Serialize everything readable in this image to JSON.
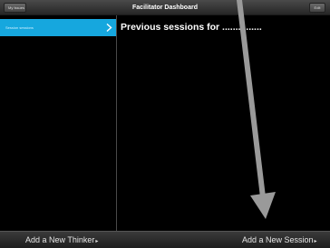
{
  "navbar": {
    "left_button": "My Issues",
    "title": "Facilitator Dashboard",
    "right_button": "Edit"
  },
  "master": {
    "selected_row": "Session sessions"
  },
  "detail": {
    "title": "Previous sessions for .......  ......."
  },
  "toolbar": {
    "add_thinker": "Add a New Thinker",
    "add_session": "Add a New Session",
    "caret": "▸"
  },
  "colors": {
    "selection": "#16a7de",
    "arrow": "#9a9a9a"
  }
}
